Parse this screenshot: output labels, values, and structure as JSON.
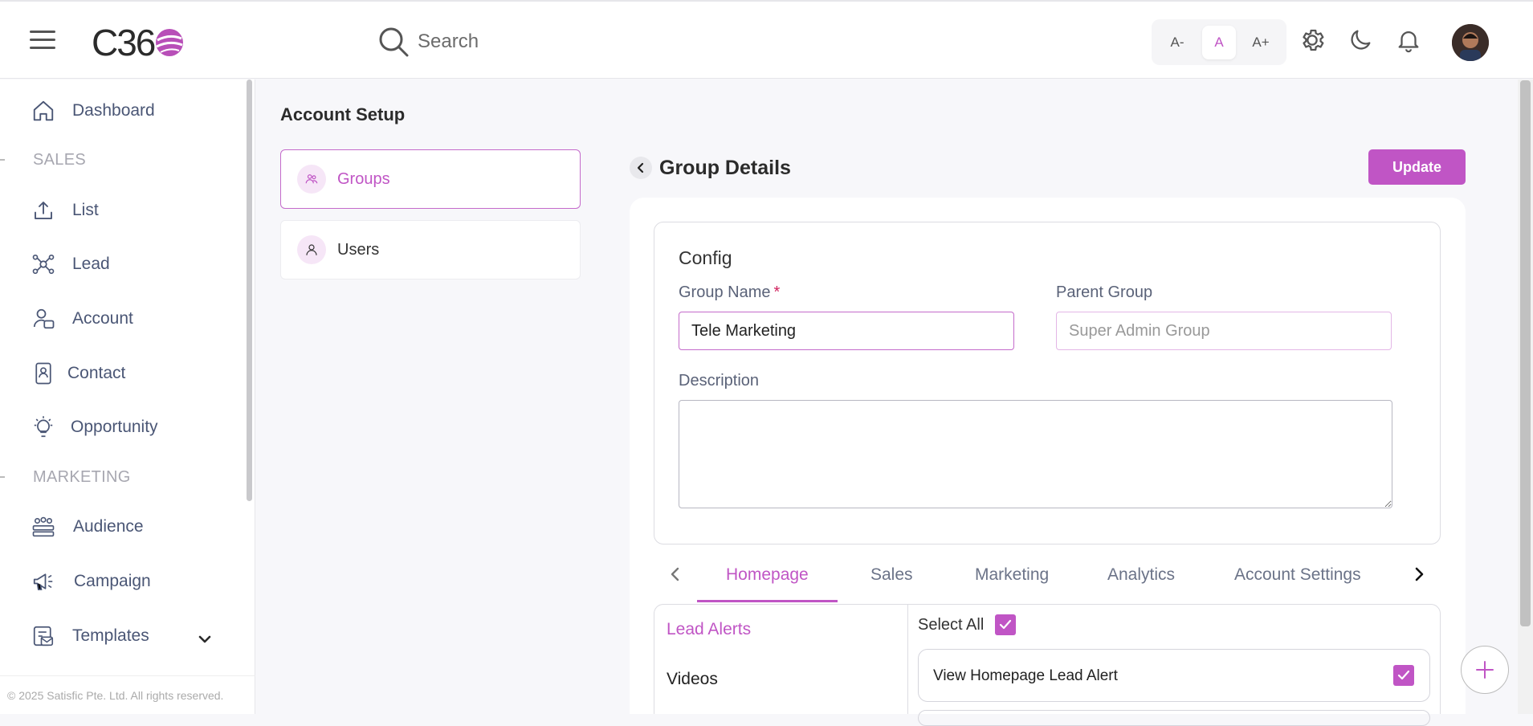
{
  "header": {
    "logo_text": "C36",
    "search_placeholder": "Search",
    "font_size_buttons": [
      "A-",
      "A",
      "A+"
    ],
    "icons": [
      "gear-icon",
      "moon-icon",
      "bell-icon"
    ],
    "accent_color": "#c055c5"
  },
  "sidebar": {
    "items": [
      {
        "label": "Dashboard",
        "icon": "home-icon"
      },
      {
        "label": "List",
        "icon": "upload-icon"
      },
      {
        "label": "Lead",
        "icon": "network-icon"
      },
      {
        "label": "Account",
        "icon": "user-card-icon"
      },
      {
        "label": "Contact",
        "icon": "contact-book-icon"
      },
      {
        "label": "Opportunity",
        "icon": "lightbulb-icon"
      },
      {
        "label": "Audience",
        "icon": "audience-icon"
      },
      {
        "label": "Campaign",
        "icon": "megaphone-icon"
      },
      {
        "label": "Templates",
        "icon": "templates-icon"
      }
    ],
    "sections": {
      "sales": "SALES",
      "marketing": "MARKETING"
    },
    "footer": "© 2025 Satisfic Pte. Ltd. All rights reserved."
  },
  "page": {
    "title": "Account Setup",
    "side_cards": [
      {
        "label": "Groups",
        "active": true
      },
      {
        "label": "Users",
        "active": false
      }
    ]
  },
  "details": {
    "title": "Group Details",
    "update_label": "Update",
    "config_title": "Config",
    "group_name_label": "Group Name",
    "required_mark": "*",
    "group_name_value": "Tele Marketing",
    "parent_group_label": "Parent Group",
    "parent_group_placeholder": "Super Admin Group",
    "description_label": "Description",
    "description_value": ""
  },
  "tabs": {
    "items": [
      "Homepage",
      "Sales",
      "Marketing",
      "Analytics",
      "Account Settings"
    ],
    "active": "Homepage"
  },
  "permissions": {
    "categories": [
      "Lead Alerts",
      "Videos"
    ],
    "active_category": "Lead Alerts",
    "select_all_label": "Select All",
    "select_all_checked": true,
    "rows": [
      {
        "label": "View Homepage Lead Alert",
        "checked": true
      }
    ]
  }
}
